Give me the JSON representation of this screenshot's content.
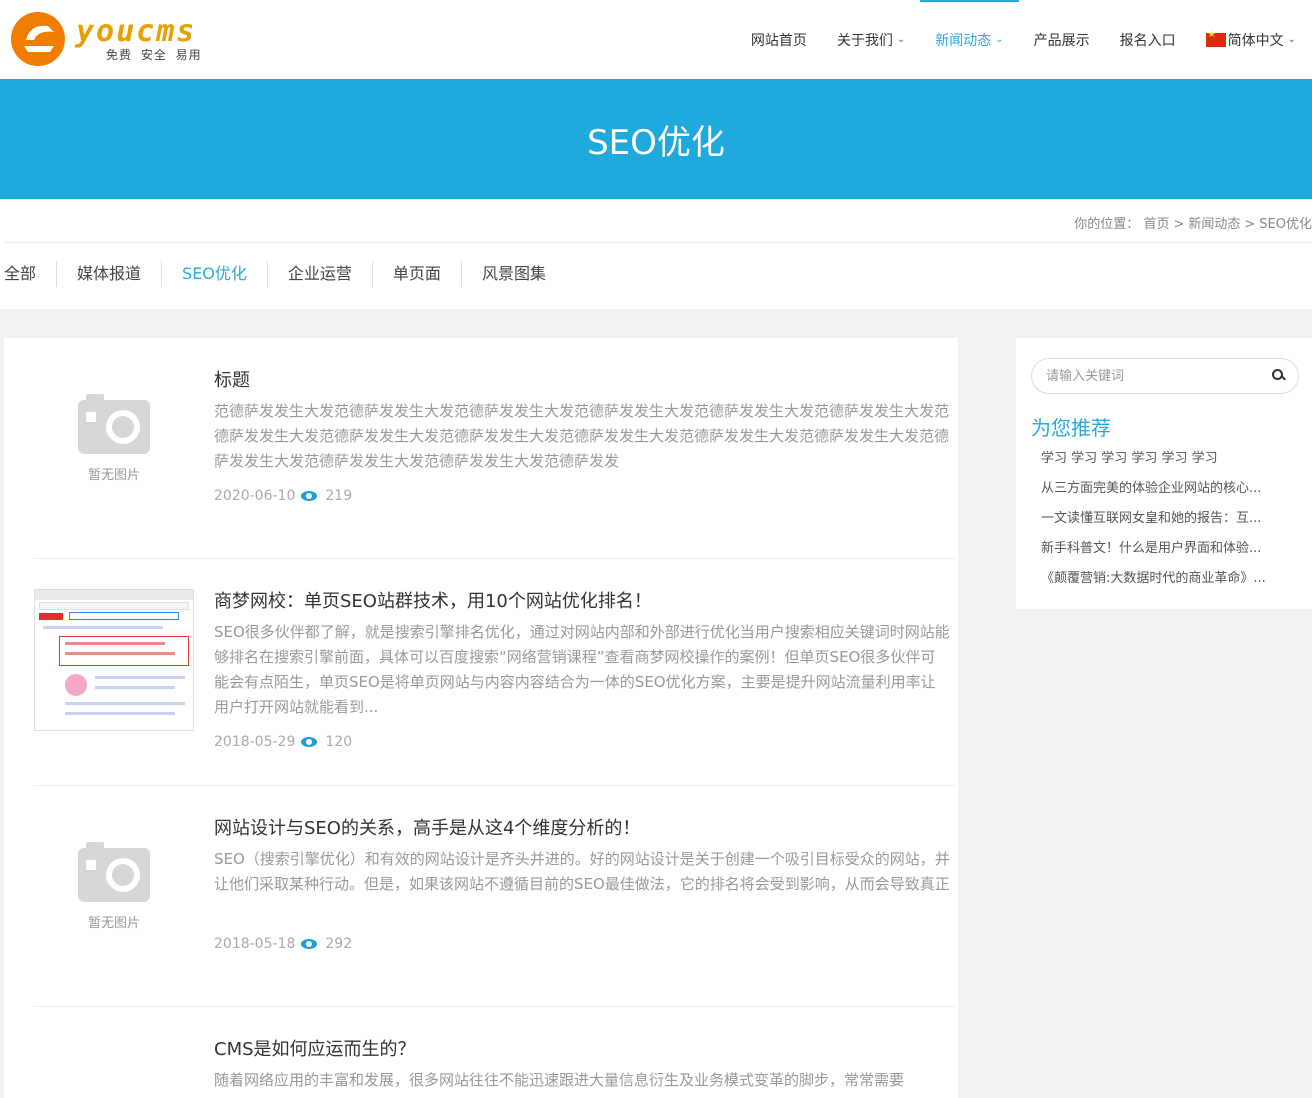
{
  "header": {
    "logo_text": "youcms",
    "logo_tagline": "免费 安全 易用",
    "nav": [
      {
        "label": "网站首页",
        "dropdown": false,
        "active": false
      },
      {
        "label": "关于我们",
        "dropdown": true,
        "active": false
      },
      {
        "label": "新闻动态",
        "dropdown": true,
        "active": true
      },
      {
        "label": "产品展示",
        "dropdown": false,
        "active": false
      },
      {
        "label": "报名入口",
        "dropdown": false,
        "active": false
      }
    ],
    "language": "简体中文"
  },
  "banner": {
    "title": "SEO优化"
  },
  "breadcrumb": {
    "prefix": "你的位置：",
    "items": [
      "首页",
      "新闻动态",
      "SEO优化"
    ]
  },
  "categories": [
    {
      "label": "全部",
      "active": false
    },
    {
      "label": "媒体报道",
      "active": false
    },
    {
      "label": "SEO优化",
      "active": true
    },
    {
      "label": "企业运营",
      "active": false
    },
    {
      "label": "单页面",
      "active": false
    },
    {
      "label": "风景图集",
      "active": false
    }
  ],
  "posts": [
    {
      "title": "标题",
      "excerpt": "范德萨发发生大发范德萨发发生大发范德萨发发生大发范德萨发发生大发范德萨发发生大发范德萨发发生大发范德萨发发生大发范德萨发发生大发范德萨发发生大发范德萨发发生大发范德萨发发生大发范德萨发发生大发范德萨发发生大发范德萨发发生大发范德萨发发生大发范德萨发发",
      "date": "2020-06-10",
      "views": "219",
      "thumb": "noimage",
      "noimage_label": "暂无图片"
    },
    {
      "title": "商梦网校：单页SEO站群技术，用10个网站优化排名！",
      "excerpt": "SEO很多伙伴都了解，就是搜索引擎排名优化，通过对网站内部和外部进行优化当用户搜索相应关键词时网站能够排名在搜索引擎前面，具体可以百度搜索“网络营销课程”查看商梦网校操作的案例！但单页SEO很多伙伴可能会有点陌生，单页SEO是将单页网站与内容内容结合为一体的SEO优化方案，主要是提升网站流量利用率让用户打开网站就能看到...",
      "date": "2018-05-29",
      "views": "120",
      "thumb": "screenshot"
    },
    {
      "title": "网站设计与SEO的关系，高手是从这4个维度分析的！",
      "excerpt": "SEO（搜索引擎优化）和有效的网站设计是齐头并进的。好的网站设计是关于创建一个吸引目标受众的网站，并让他们采取某种行动。但是，如果该网站不遵循目前的SEO最佳做法，它的排名将会受到影响，从而会导致真正",
      "date": "2018-05-18",
      "views": "292",
      "thumb": "noimage",
      "noimage_label": "暂无图片"
    },
    {
      "title": "CMS是如何应运而生的？",
      "excerpt": "随着网络应用的丰富和发展，很多网站往往不能迅速跟进大量信息衍生及业务模式变革的脚步，常常需要",
      "thumb": "none"
    }
  ],
  "sidebar": {
    "search_placeholder": "请输入关键词",
    "recommend_title": "为您推荐",
    "recommend": [
      "学习 学习 学习 学习 学习 学习",
      "从三方面完美的体验企业网站的核心...",
      "一文读懂互联网女皇和她的报告：互...",
      "新手科普文！什么是用户界面和体验...",
      "《颠覆营销:大数据时代的商业革命》..."
    ]
  },
  "colors": {
    "accent": "#27a9e1",
    "banner": "#1fa9dd",
    "logo": "#e8a000"
  }
}
